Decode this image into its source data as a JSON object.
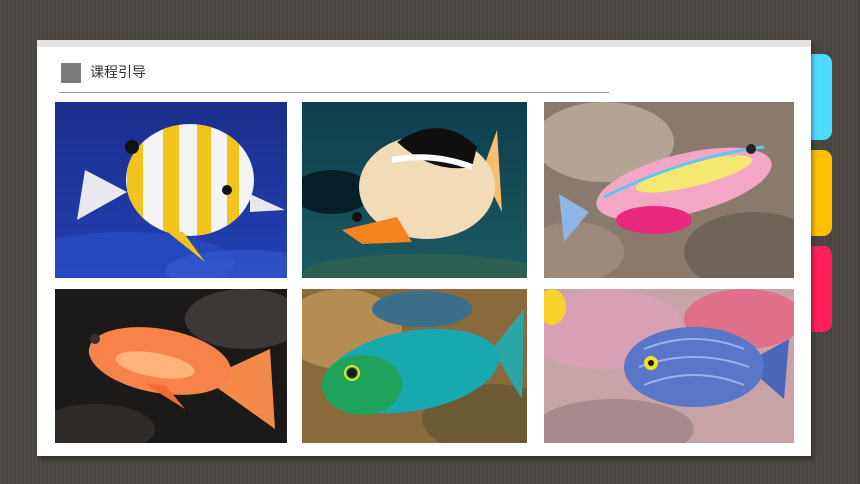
{
  "header": {
    "title": "课程引导"
  },
  "side_tabs": {
    "colors": [
      "#4bdcff",
      "#ffc000",
      "#ff1f5a"
    ]
  },
  "photos": [
    {
      "subject": "copperband-butterflyfish"
    },
    {
      "subject": "saddled-butterflyfish"
    },
    {
      "subject": "pink-wrasse"
    },
    {
      "subject": "orange-anthias"
    },
    {
      "subject": "green-unicornfish"
    },
    {
      "subject": "blue-striped-tang"
    }
  ]
}
